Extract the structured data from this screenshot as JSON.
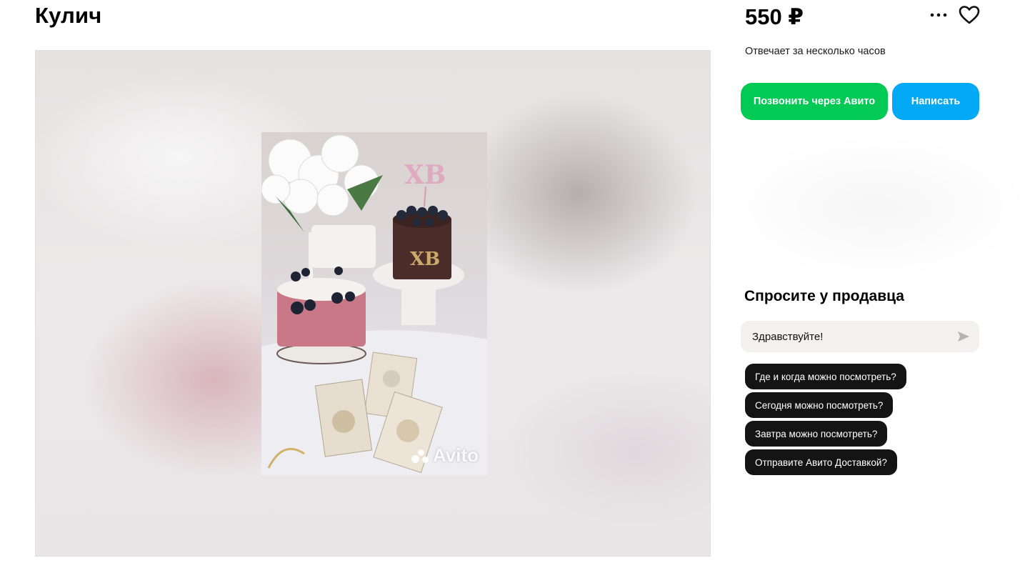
{
  "listing": {
    "title": "Кулич",
    "price": "550 ₽",
    "reply_time": "Отвечает за несколько часов"
  },
  "gallery": {
    "watermark": "Avito"
  },
  "actions": {
    "call_label": "Позвонить через Авито",
    "write_label": "Написать",
    "call_color": "#03c955",
    "write_color": "#03a9f5"
  },
  "ask_seller": {
    "title": "Спросите у продавца",
    "input_value": "Здравствуйте!",
    "quick_questions": [
      "Где и когда можно посмотреть?",
      "Сегодня можно посмотреть?",
      "Завтра можно посмотреть?",
      "Отправите Авито Доставкой?"
    ]
  },
  "icons": {
    "more": "more-dots-icon",
    "favorite": "heart-icon",
    "send": "send-arrow-icon"
  }
}
